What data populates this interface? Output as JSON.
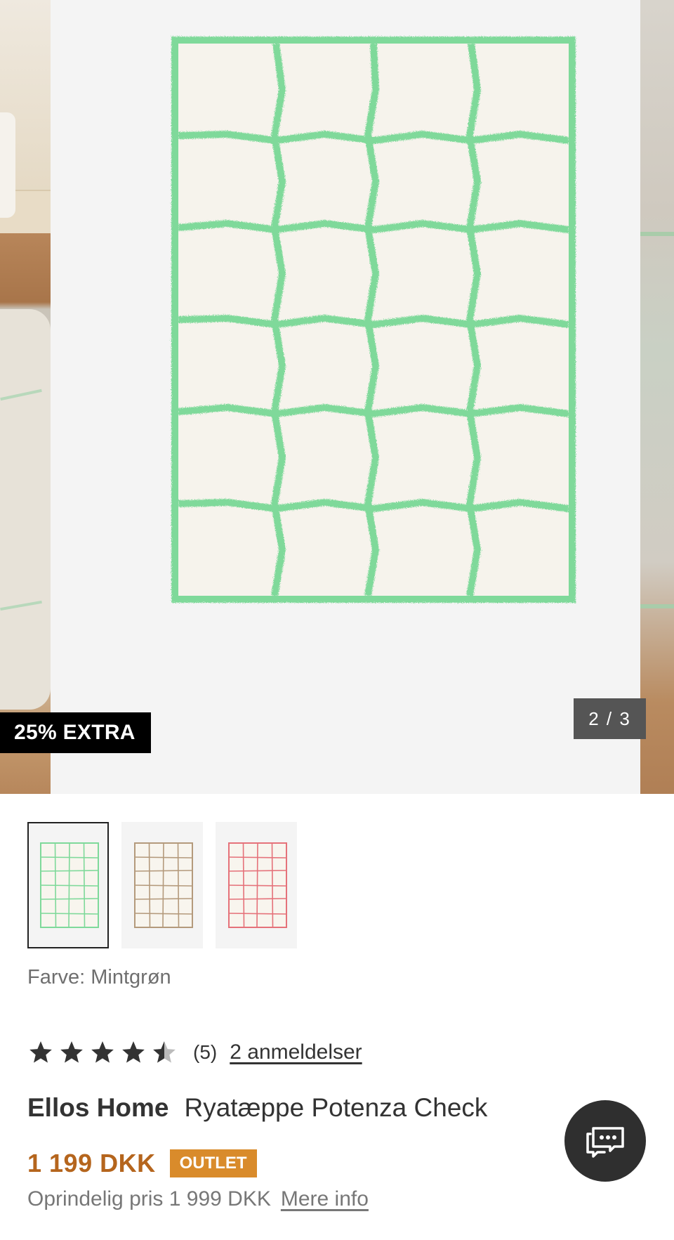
{
  "gallery": {
    "promo_badge": "25% EXTRA",
    "slide_counter": "2 / 3",
    "main_image_alt": "mint-green-grid-shag-rug",
    "thumbnails": [
      {
        "name": "mint",
        "grid_color": "#7fd99a",
        "selected": true
      },
      {
        "name": "beige",
        "grid_color": "#b49a7c",
        "selected": false
      },
      {
        "name": "pink",
        "grid_color": "#e5727a",
        "selected": false
      }
    ]
  },
  "product": {
    "color_label": "Farve: Mintgrøn",
    "rating_value": 4.5,
    "rating_score_text": "(5)",
    "reviews_link": "2 anmeldelser",
    "brand": "Ellos Home",
    "name": "Ryatæppe Potenza Check",
    "price": "1 199 DKK",
    "badge": "OUTLET",
    "original_price_text": "Oprindelig pris 1 999 DKK",
    "more_info_link": "Mere info"
  },
  "colors": {
    "price": "#b5651d",
    "outlet_badge": "#d98b2b",
    "rug_grid": "#7fd99a",
    "rug_base": "#f6f3ec"
  },
  "icons": {
    "chat": "chat-bubble-icon",
    "star": "star-icon"
  }
}
